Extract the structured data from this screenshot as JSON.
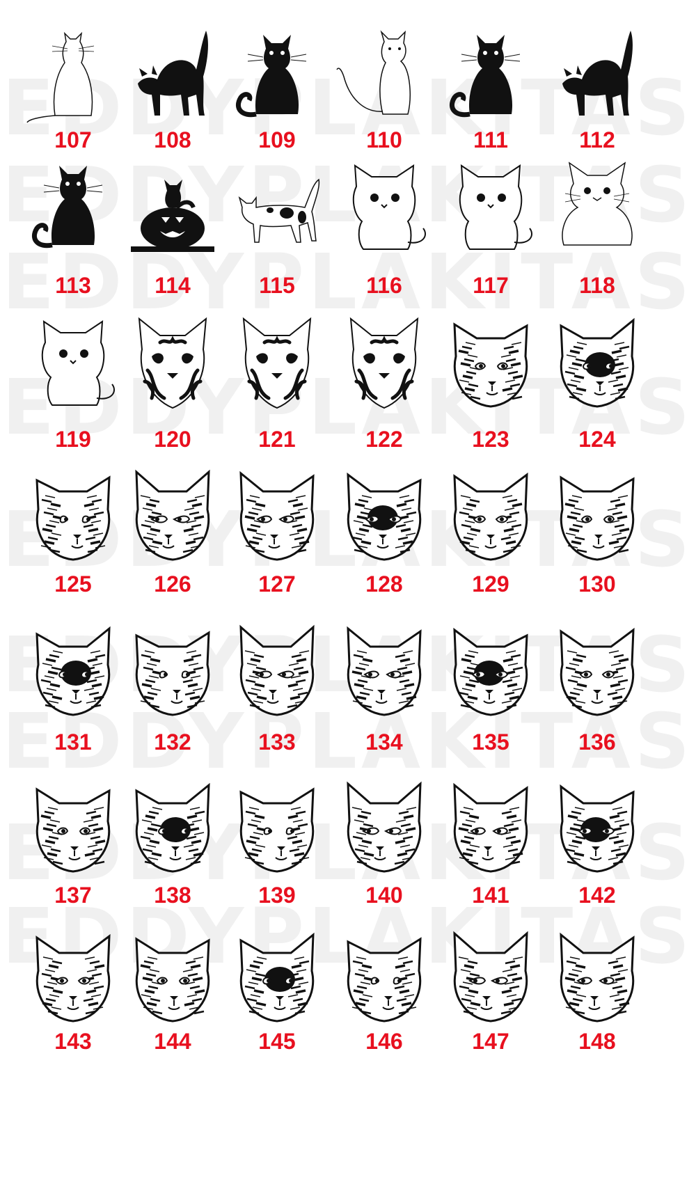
{
  "watermark": "EDDYPLAKITAS",
  "watermark_partial": "EDDYPLAKITAS",
  "accent_color": "#e8101f",
  "rows": [
    {
      "items": [
        {
          "number": "107",
          "style": "outline-back-icon"
        },
        {
          "number": "108",
          "style": "black-arched-icon"
        },
        {
          "number": "109",
          "style": "black-sitting-icon"
        },
        {
          "number": "110",
          "style": "outline-sitting-icon"
        },
        {
          "number": "111",
          "style": "black-sitting-icon"
        },
        {
          "number": "112",
          "style": "black-arched-icon"
        }
      ]
    },
    {
      "items": [
        {
          "number": "113",
          "style": "black-sitting-icon"
        },
        {
          "number": "114",
          "style": "pumpkin-cat-icon"
        },
        {
          "number": "115",
          "style": "spotted-walking-icon"
        },
        {
          "number": "116",
          "style": "cartoon-cat-icon"
        },
        {
          "number": "117",
          "style": "cartoon-cat-icon"
        },
        {
          "number": "118",
          "style": "kitten-icon"
        }
      ]
    },
    {
      "items": [
        {
          "number": "119",
          "style": "cartoon-cat-icon"
        },
        {
          "number": "120",
          "style": "tribal-cat-head-icon"
        },
        {
          "number": "121",
          "style": "tribal-cat-head-icon"
        },
        {
          "number": "122",
          "style": "tribal-cat-head-icon"
        },
        {
          "number": "123",
          "style": "sketch-cat-head-icon"
        },
        {
          "number": "124",
          "style": "sketch-cat-head-icon"
        }
      ]
    },
    {
      "items": [
        {
          "number": "125",
          "style": "sketch-cat-head-icon"
        },
        {
          "number": "126",
          "style": "sketch-cat-head-icon"
        },
        {
          "number": "127",
          "style": "sketch-cat-head-icon"
        },
        {
          "number": "128",
          "style": "sketch-cat-head-icon"
        },
        {
          "number": "129",
          "style": "sketch-cat-head-icon"
        },
        {
          "number": "130",
          "style": "sketch-cat-head-icon"
        }
      ]
    },
    {
      "items": [
        {
          "number": "131",
          "style": "sketch-cat-head-icon"
        },
        {
          "number": "132",
          "style": "sketch-cat-head-icon"
        },
        {
          "number": "133",
          "style": "sketch-cat-head-icon"
        },
        {
          "number": "134",
          "style": "sketch-cat-head-icon"
        },
        {
          "number": "135",
          "style": "sketch-cat-head-icon"
        },
        {
          "number": "136",
          "style": "sketch-cat-head-icon"
        }
      ]
    },
    {
      "items": [
        {
          "number": "137",
          "style": "sketch-cat-head-icon"
        },
        {
          "number": "138",
          "style": "sketch-cat-head-icon"
        },
        {
          "number": "139",
          "style": "sketch-cat-head-icon"
        },
        {
          "number": "140",
          "style": "sketch-cat-head-icon"
        },
        {
          "number": "141",
          "style": "sketch-cat-head-icon"
        },
        {
          "number": "142",
          "style": "sketch-cat-head-icon"
        }
      ]
    },
    {
      "items": [
        {
          "number": "143",
          "style": "sketch-cat-head-icon"
        },
        {
          "number": "144",
          "style": "sketch-cat-head-icon"
        },
        {
          "number": "145",
          "style": "sketch-cat-head-icon"
        },
        {
          "number": "146",
          "style": "sketch-cat-head-icon"
        },
        {
          "number": "147",
          "style": "sketch-cat-head-icon"
        },
        {
          "number": "148",
          "style": "sketch-cat-head-icon"
        }
      ]
    }
  ]
}
